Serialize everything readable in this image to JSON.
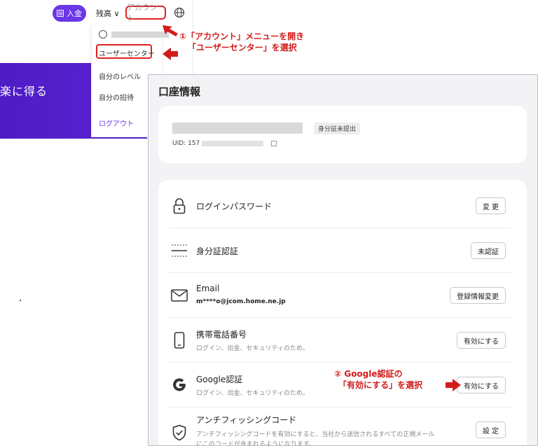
{
  "header": {
    "deposit_label": "入金",
    "balance_label": "残高 ∨",
    "account_label": "アカウント"
  },
  "hero": {
    "text": "楽に得る"
  },
  "dropdown": {
    "user_center": "ユーザーセンター",
    "my_level": "自分のレベル",
    "my_invite": "自分の招待",
    "logout": "ログアウト"
  },
  "annotations": {
    "step1_line1": "①「アカウント」メニューを開き",
    "step1_line2": "「ユーザーセンター」を選択",
    "step2_line1": "② Google認証の",
    "step2_line2": "「有効にする」を選択"
  },
  "account_info": {
    "title": "口座情報",
    "id_badge": "身分証未提出",
    "uid_prefix": "UID: 157"
  },
  "security": [
    {
      "icon": "lock-icon",
      "title": "ログインパスワード",
      "subtitle": "",
      "button": "変 更"
    },
    {
      "icon": "id-card-icon",
      "title": "身分証認証",
      "subtitle": "",
      "button": "未認証"
    },
    {
      "icon": "mail-icon",
      "title": "Email",
      "subtitle": "m****o@jcom.home.ne.jp",
      "button": "登録情報変更"
    },
    {
      "icon": "phone-icon",
      "title": "携帯電話番号",
      "subtitle": "ログイン、出金、セキュリティのため。",
      "button": "有効にする"
    },
    {
      "icon": "google-icon",
      "title": "Google認証",
      "subtitle": "ログイン、出金、セキュリティのため。",
      "button": "有効にする"
    },
    {
      "icon": "shield-icon",
      "title": "アンチフィッシングコード",
      "subtitle": "アンチフィッシングコードを有効にすると、当社から送信されるすべての正規メール",
      "subtitle2": "にこのコードが含まれるようになります。",
      "button": "設 定"
    }
  ],
  "colors": {
    "brand": "#6a36e6",
    "annotation": "#d21c1c"
  }
}
